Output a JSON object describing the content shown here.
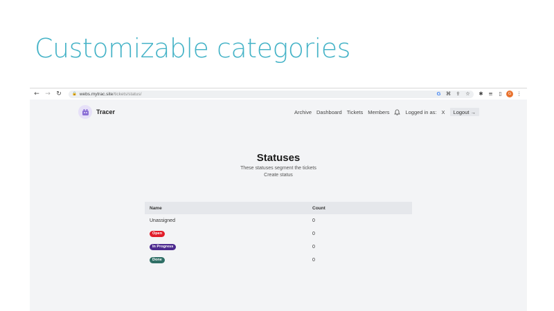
{
  "slide": {
    "title": "Customizable categories"
  },
  "browser": {
    "url_host": "webs.mytrac.site",
    "url_path": "/tickets/status/",
    "avatar_letter": "G"
  },
  "app": {
    "brand": "Tracer",
    "nav": [
      "Archive",
      "Dashboard",
      "Tickets",
      "Members"
    ],
    "logged_in_label": "Logged in as:",
    "logged_in_user": "X",
    "logout_label": "Logout →"
  },
  "page": {
    "heading": "Statuses",
    "subtitle": "These statuses segment the tickets",
    "create_link": "Create status"
  },
  "table": {
    "headers": {
      "name": "Name",
      "count": "Count"
    },
    "rows": [
      {
        "name": "Unassigned",
        "count": "0",
        "badge": false,
        "color": ""
      },
      {
        "name": "Open",
        "count": "0",
        "badge": true,
        "color": "#e11d2a"
      },
      {
        "name": "In Progress",
        "count": "0",
        "badge": true,
        "color": "#4c2a8f"
      },
      {
        "name": "Done",
        "count": "0",
        "badge": true,
        "color": "#2f6f66"
      }
    ]
  }
}
